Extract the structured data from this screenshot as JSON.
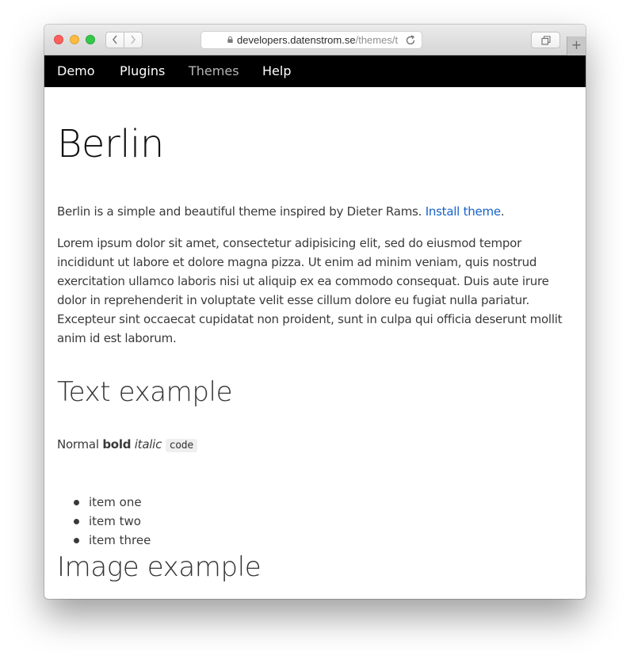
{
  "browser": {
    "url_host": "developers.datenstrom.se",
    "url_path": "/themes/t",
    "back_icon": "chevron-left-icon",
    "forward_icon": "chevron-right-icon",
    "reload_icon": "reload-icon",
    "tabs_icon": "tab-overview-icon",
    "new_tab_label": "+",
    "traffic_light_colors": [
      "#fc605c",
      "#fdbc40",
      "#34c84a"
    ]
  },
  "nav": {
    "items": [
      {
        "label": "Demo"
      },
      {
        "label": "Plugins"
      },
      {
        "label": "Themes"
      },
      {
        "label": "Help"
      }
    ],
    "active_item": "Themes"
  },
  "page": {
    "title": "Berlin",
    "intro_text": "Berlin is a simple and beautiful theme inspired by Dieter Rams.",
    "intro_link": "Install theme",
    "intro_end": ".",
    "lorem": "Lorem ipsum dolor sit amet, consectetur adipisicing elit, sed do eiusmod tempor incididunt ut labore et dolore magna pizza. Ut enim ad minim veniam, quis nostrud exercitation ullamco laboris nisi ut aliquip ex ea commodo consequat. Duis aute irure dolor in reprehenderit in voluptate velit esse cillum dolore eu fugiat nulla pariatur. Excepteur sint occaecat cupidatat non proident, sunt in culpa qui officia deserunt mollit anim id est laborum.",
    "text_heading": "Text example",
    "normal": "Normal",
    "bold": "bold",
    "italic": "italic",
    "code": "code",
    "list": [
      "item one",
      "item two",
      "item three"
    ],
    "image_heading": "Image example"
  },
  "colors": {
    "link": "#1662c7",
    "nav_background": "#000000",
    "nav_active": "#b5b5b5"
  }
}
